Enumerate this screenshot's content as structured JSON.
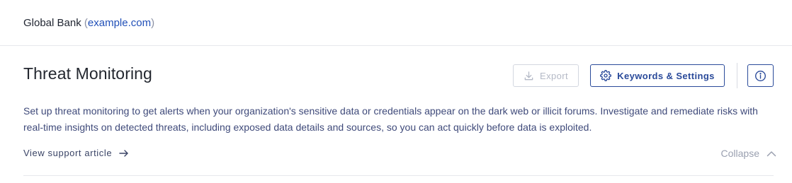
{
  "header": {
    "org_name": "Global Bank",
    "paren_open": "(",
    "domain": "example.com",
    "paren_close": ")"
  },
  "page": {
    "title": "Threat Monitoring",
    "description": "Set up threat monitoring to get alerts when your organization's sensitive data or credentials appear on the dark web or illicit forums. Investigate and remediate risks with real-time insights on detected threats, including exposed data details and sources, so you can act quickly before data is exploited.",
    "support_link": "View support article",
    "collapse_label": "Collapse"
  },
  "toolbar": {
    "export_label": "Export",
    "export_icon": "download-icon",
    "settings_label": "Keywords & Settings",
    "settings_icon": "gear-icon",
    "info_icon": "info-icon"
  },
  "colors": {
    "accent": "#2a4a9a",
    "link": "#2150b8",
    "description_text": "#3f4a7a",
    "disabled": "#b4b9c6"
  }
}
